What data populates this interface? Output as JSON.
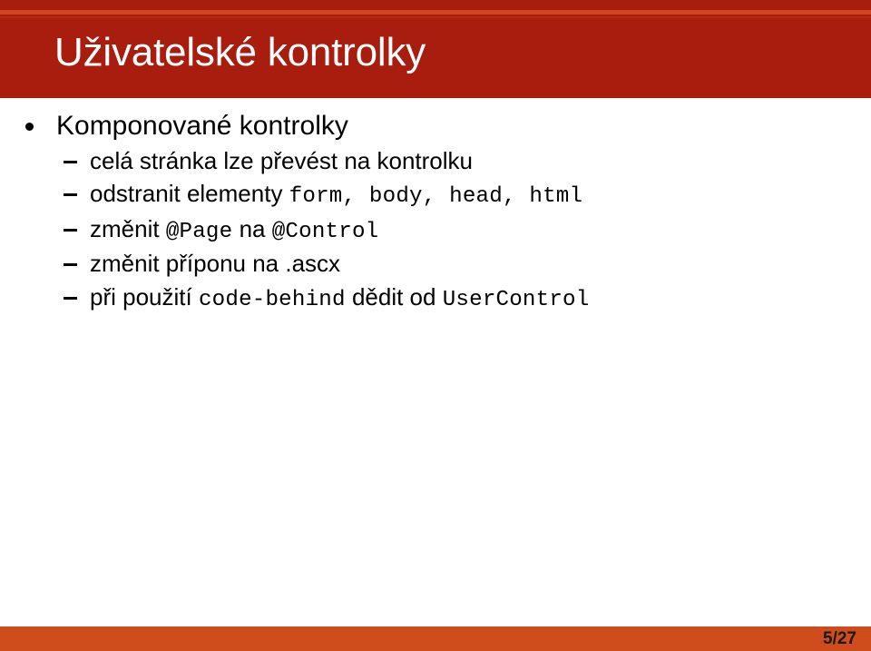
{
  "slide": {
    "title": "Uživatelské kontrolky",
    "theme": {
      "header_background": "#a81d0d",
      "header_stripe": "#cf4520",
      "footer_background": "#cf4c1c",
      "title_color": "#ffffff",
      "body_text_color": "#000000",
      "page_number_color": "#1a1a1a"
    }
  },
  "content": {
    "bullets": [
      {
        "level": 1,
        "marker": "round-bullet",
        "text": "Komponované kontrolky"
      }
    ],
    "sub_bullets": [
      {
        "level": 2,
        "marker": "dash-bullet",
        "segments": [
          {
            "type": "text",
            "value": "celá stránka lze převést na kontrolku"
          }
        ],
        "plain": "celá stránka lze převést na kontrolku"
      },
      {
        "level": 2,
        "marker": "dash-bullet",
        "segments": [
          {
            "type": "text",
            "value": "odstranit elementy "
          },
          {
            "type": "code",
            "value": "form, body, head, html"
          }
        ],
        "plain": "odstranit elementy form, body, head, html"
      },
      {
        "level": 2,
        "marker": "dash-bullet",
        "segments": [
          {
            "type": "text",
            "value": "změnit "
          },
          {
            "type": "code",
            "value": "@Page"
          },
          {
            "type": "text",
            "value": " na "
          },
          {
            "type": "code",
            "value": "@Control"
          }
        ],
        "plain": "změnit @Page na @Control"
      },
      {
        "level": 2,
        "marker": "dash-bullet",
        "segments": [
          {
            "type": "text",
            "value": "změnit příponu na .ascx"
          }
        ],
        "plain": "změnit příponu na .ascx"
      },
      {
        "level": 2,
        "marker": "dash-bullet",
        "segments": [
          {
            "type": "text",
            "value": "při použití "
          },
          {
            "type": "code",
            "value": "code-behind"
          },
          {
            "type": "text",
            "value": " dědit od "
          },
          {
            "type": "code",
            "value": "UserControl"
          }
        ],
        "plain": "při použití code-behind dědit od UserControl"
      }
    ]
  },
  "footer": {
    "page_number": "5/27"
  }
}
